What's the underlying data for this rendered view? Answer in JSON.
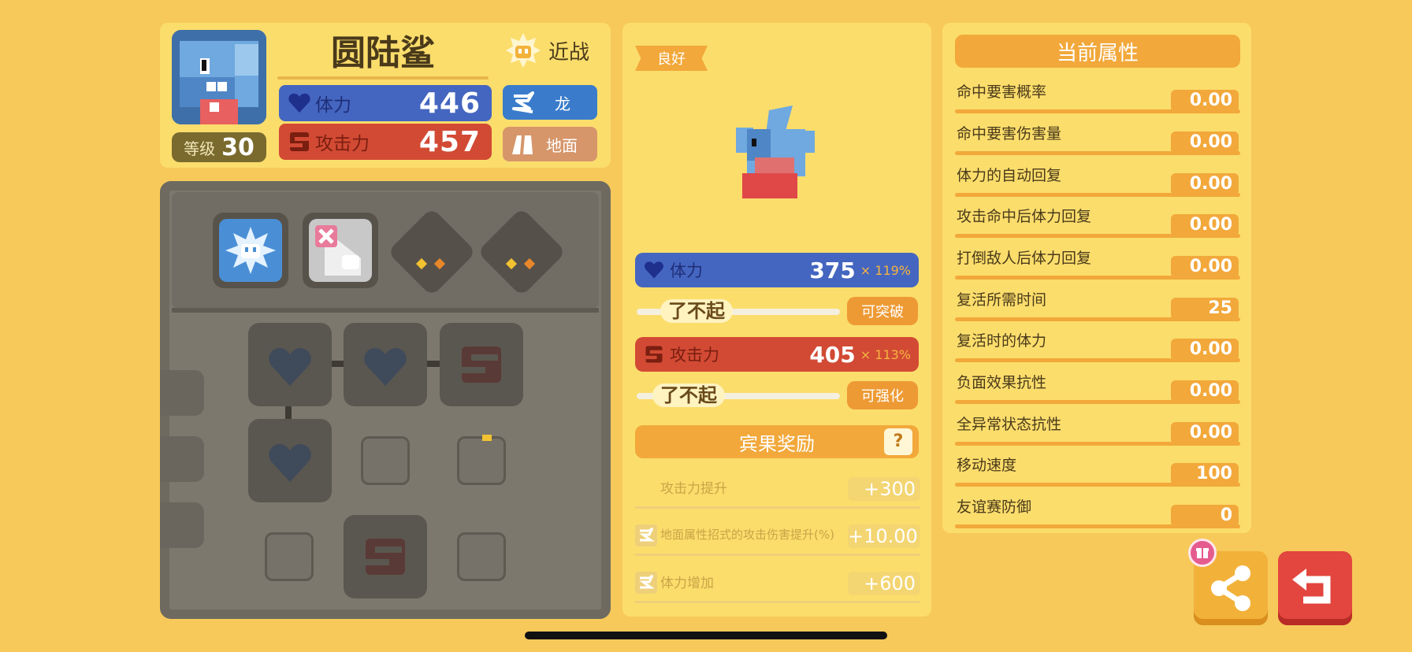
{
  "pokemon": {
    "name": "圆陆鲨",
    "level_label": "等级",
    "level_value": "30",
    "style": "近战",
    "hp_label": "体力",
    "hp_value": "446",
    "atk_label": "攻击力",
    "atk_value": "457",
    "types": [
      "龙",
      "地面"
    ]
  },
  "middle": {
    "condition_badge": "良好",
    "hp_label": "体力",
    "hp_value": "375",
    "hp_mult": "× 119%",
    "hp_grade": "了不起",
    "hp_button": "可突破",
    "atk_label": "攻击力",
    "atk_value": "405",
    "atk_mult": "× 113%",
    "atk_grade": "了不起",
    "atk_button": "可强化",
    "bingo_title": "宾果奖励",
    "bingo_help": "?",
    "bonuses": [
      {
        "label": "攻击力提升",
        "value": "+300"
      },
      {
        "label": "地面属性招式的攻击伤害提升(%)",
        "value": "+10.00"
      },
      {
        "label": "体力增加",
        "value": "+600"
      }
    ]
  },
  "attributes": {
    "title": "当前属性",
    "rows": [
      {
        "label": "命中要害概率",
        "value": "0.00"
      },
      {
        "label": "命中要害伤害量",
        "value": "0.00"
      },
      {
        "label": "体力的自动回复",
        "value": "0.00"
      },
      {
        "label": "攻击命中后体力回复",
        "value": "0.00"
      },
      {
        "label": "打倒敌人后体力回复",
        "value": "0.00"
      },
      {
        "label": "复活所需时间",
        "value": "25"
      },
      {
        "label": "复活时的体力",
        "value": "0.00"
      },
      {
        "label": "负面效果抗性",
        "value": "0.00"
      },
      {
        "label": "全异常状态抗性",
        "value": "0.00"
      },
      {
        "label": "移动速度",
        "value": "100"
      },
      {
        "label": "友谊赛防御",
        "value": "0"
      }
    ]
  },
  "icons": {
    "share": "share-icon",
    "back": "back-arrow-icon",
    "gift": "gift-icon",
    "heart": "heart-icon",
    "fist": "attack-icon",
    "dragon": "dragon-type-icon",
    "ground": "ground-type-icon"
  },
  "colors": {
    "background": "#F6C95A",
    "hp_blue": "#4466C0",
    "atk_red": "#D24A34",
    "accent_orange": "#F2A83A"
  }
}
